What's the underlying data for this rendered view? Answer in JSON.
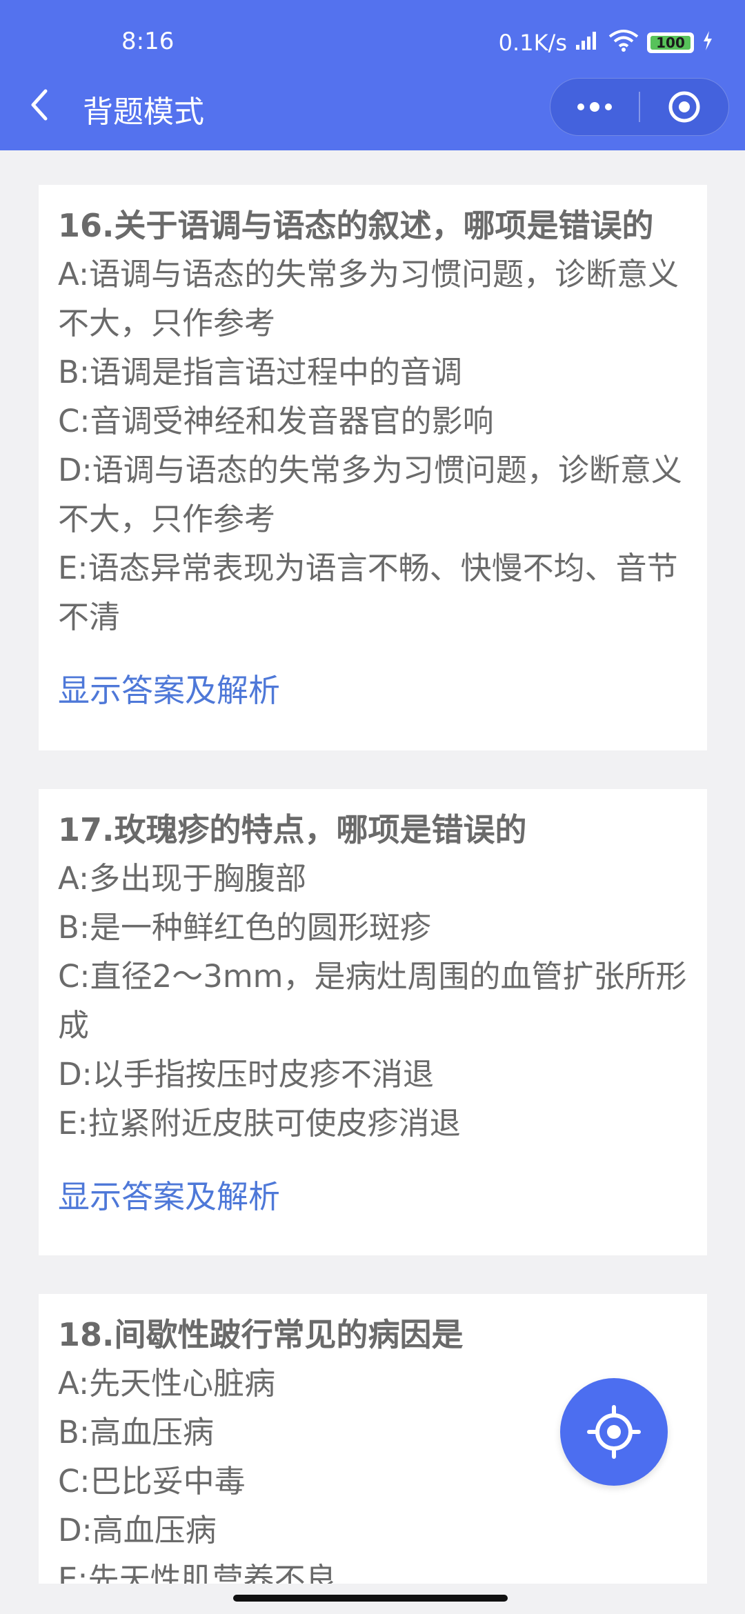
{
  "status_bar": {
    "time": "8:16",
    "network_speed": "0.1K/s",
    "battery": "100"
  },
  "nav": {
    "title": "背题模式"
  },
  "questions": [
    {
      "title": "16.关于语调与语态的叙述，哪项是错误的",
      "options": [
        "A:语调与语态的失常多为习惯问题，诊断意义不大，只作参考",
        "B:语调是指言语过程中的音调",
        "C:音调受神经和发音器官的影响",
        "D:语调与语态的失常多为习惯问题，诊断意义不大，只作参考",
        "E:语态异常表现为语言不畅、快慢不均、音节不清"
      ],
      "show_answer": "显示答案及解析"
    },
    {
      "title": "17.玫瑰疹的特点，哪项是错误的",
      "options": [
        "A:多出现于胸腹部",
        "B:是一种鲜红色的圆形斑疹",
        "C:直径2～3mm，是病灶周围的血管扩张所形成",
        "D:以手指按压时皮疹不消退",
        "E:拉紧附近皮肤可使皮疹消退"
      ],
      "show_answer": "显示答案及解析"
    },
    {
      "title": "18.间歇性跛行常见的病因是",
      "options": [
        "A:先天性心脏病",
        "B:高血压病",
        "C:巴比妥中毒",
        "D:高血压病",
        "E:先天性肌营养不良"
      ]
    }
  ],
  "colors": {
    "header_bg": "#5472ee",
    "link": "#4e78d8",
    "fab": "#4c6ef0"
  },
  "icons": [
    "back-icon",
    "more-icon",
    "target-icon",
    "locate-icon",
    "signal-icon",
    "wifi-icon",
    "battery-icon",
    "charging-icon"
  ]
}
